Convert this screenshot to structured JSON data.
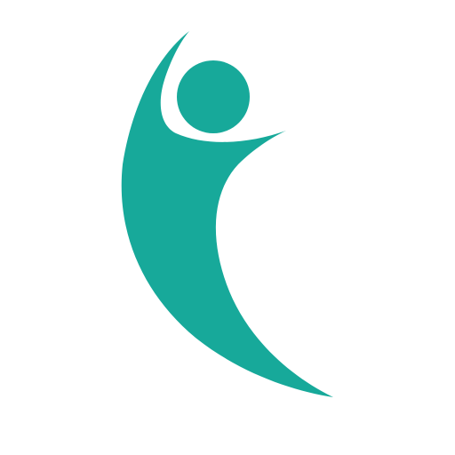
{
  "logo": {
    "icon": "human-figure-icon",
    "colors": {
      "figure": "#17a99a",
      "background": "#ffffff"
    }
  }
}
